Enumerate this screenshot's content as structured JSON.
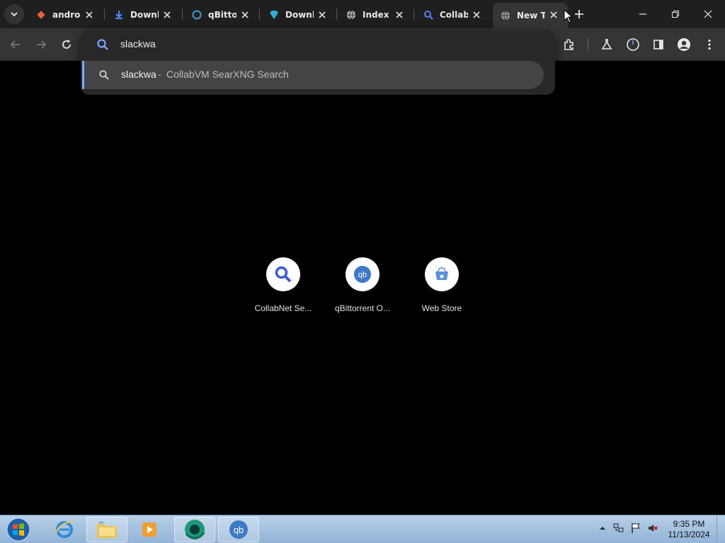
{
  "tabs": [
    {
      "title": "androi",
      "icon": "diamond-icon",
      "color": "#e8643c"
    },
    {
      "title": "Downl",
      "icon": "download-icon",
      "color": "#4f8cff"
    },
    {
      "title": "qBittor",
      "icon": "qbittorrent-icon",
      "color": "#3aa0c8"
    },
    {
      "title": "Downl",
      "icon": "diamond-icon",
      "color": "#2ab0d8"
    },
    {
      "title": "Index c",
      "icon": "globe-icon",
      "color": "#bbbbbb"
    },
    {
      "title": "Collab",
      "icon": "search-icon",
      "color": "#5b7cff"
    },
    {
      "title": "New Ta",
      "icon": "globe-icon",
      "color": "#9a9a9a",
      "active": true
    }
  ],
  "omnibox": {
    "query": "slackwa",
    "suggestion_query": "slackwa",
    "suggestion_separator": "-",
    "suggestion_engine": "CollabVM SearXNG Search"
  },
  "shortcuts": [
    {
      "label": "CollabNet Se...",
      "icon": "search-icon"
    },
    {
      "label": "qBittorrent O...",
      "icon": "qbittorrent-icon"
    },
    {
      "label": "Web Store",
      "icon": "web-store-icon"
    }
  ],
  "taskbar": {
    "apps": [
      "internet-explorer-icon",
      "file-explorer-icon",
      "media-player-icon",
      "browser-icon",
      "qbittorrent-icon"
    ],
    "time": "9:35 PM",
    "date": "11/13/2024"
  },
  "colors": {
    "tabstrip_bg": "#1f1f1f",
    "toolbar_bg": "#353535",
    "accent": "#7aa7ff"
  }
}
